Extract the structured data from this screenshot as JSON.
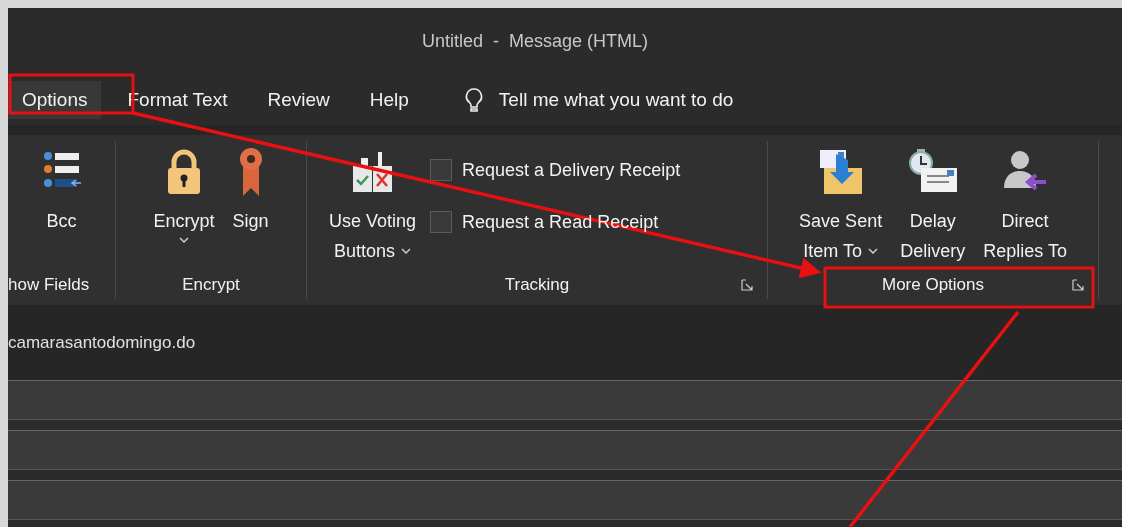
{
  "window": {
    "title": "Untitled  -  Message (HTML)"
  },
  "tabs": [
    {
      "label": "Options",
      "selected": true
    },
    {
      "label": "Format Text",
      "selected": false
    },
    {
      "label": "Review",
      "selected": false
    },
    {
      "label": "Help",
      "selected": false
    }
  ],
  "tell_me": {
    "placeholder": "Tell me what you want to do"
  },
  "ribbon": {
    "groups": [
      {
        "label": "how Fields",
        "launcher": false,
        "items": [
          {
            "lines": [
              "Bcc"
            ],
            "dropdown": false
          }
        ]
      },
      {
        "label": "Encrypt",
        "launcher": false,
        "items": [
          {
            "lines": [
              "Encrypt"
            ],
            "dropdown": true
          },
          {
            "lines": [
              "Sign"
            ],
            "dropdown": false
          }
        ]
      },
      {
        "label": "Tracking",
        "launcher": true,
        "items": [
          {
            "lines": [
              "Use Voting",
              "Buttons"
            ],
            "dropdown": true
          }
        ],
        "checkboxes": [
          {
            "label": "Request a Delivery Receipt",
            "checked": false
          },
          {
            "label": "Request a Read Receipt",
            "checked": false
          }
        ]
      },
      {
        "label": "More Options",
        "launcher": true,
        "items": [
          {
            "lines": [
              "Save Sent",
              "Item To"
            ],
            "dropdown": true
          },
          {
            "lines": [
              "Delay",
              "Delivery"
            ],
            "dropdown": false
          },
          {
            "lines": [
              "Direct",
              "Replies To"
            ],
            "dropdown": false
          }
        ]
      }
    ]
  },
  "address": {
    "text": "camarasantodomingo.do"
  }
}
